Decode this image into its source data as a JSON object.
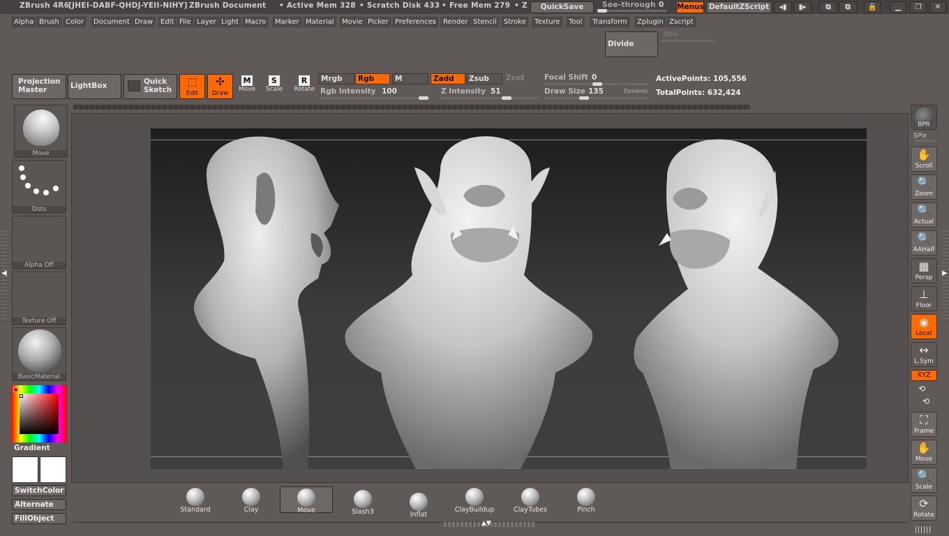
{
  "titlebar": {
    "app": "ZBrush 4R6",
    "serial": "[JHEI-DABF-QHDJ-YEII-NIHY]",
    "document": "ZBrush Document",
    "active_mem": "• Active Mem 328",
    "scratch_disk": "• Scratch Disk 433",
    "free_mem": "• Free Mem 279",
    "z_trunc": "• Z",
    "quicksave": "QuickSave",
    "see_through": "See-through",
    "see_through_value": "0",
    "menus": "Menus",
    "default_zscript": "DefaultZScript"
  },
  "menubar": {
    "items": [
      "Alpha",
      "Brush",
      "Color",
      "Document",
      "Draw",
      "Edit",
      "File",
      "Layer",
      "Light",
      "Macro",
      "Marker",
      "Material",
      "Movie",
      "Picker",
      "Preferences",
      "Render",
      "Stencil",
      "Stroke",
      "Texture",
      "Tool",
      "Transform",
      "Zplugin",
      "Zscript"
    ]
  },
  "subtool": {
    "divide": "Divide",
    "sdiv": "SDiv"
  },
  "shelf": {
    "projection_master_1": "Projection",
    "projection_master_2": "Master",
    "lightbox": "LightBox",
    "quick_sketch_1": "Quick",
    "quick_sketch_2": "Sketch",
    "edit": "Edit",
    "draw": "Draw",
    "move": "Move",
    "scale": "Scale",
    "rotate": "Rotate",
    "mrgb": "Mrgb",
    "rgb": "Rgb",
    "m": "M",
    "zadd": "Zadd",
    "zsub": "Zsub",
    "zcut": "Zcut",
    "rgb_intensity_label": "Rgb Intensity",
    "rgb_intensity_value": "100",
    "z_intensity_label": "Z Intensity",
    "z_intensity_value": "51",
    "focal_shift_label": "Focal Shift",
    "focal_shift_value": "0",
    "draw_size_label": "Draw Size",
    "draw_size_value": "135",
    "dynamic": "Dynamic",
    "active_points": "ActivePoints: 105,556",
    "total_points": "TotalPoints: 632,424"
  },
  "left_panel": {
    "brush_caption": "Move",
    "stroke_caption": "Dots",
    "alpha_caption": "Alpha  Off",
    "texture_caption": "Texture  Off",
    "material_caption": "BasicMaterial",
    "gradient": "Gradient",
    "switch_color": "SwitchColor",
    "alternate": "Alternate",
    "fill_object": "FillObject"
  },
  "right_panel": {
    "bpr": "BPR",
    "spix": "SPix",
    "scroll": "Scroll",
    "zoom": "Zoom",
    "actual": "Actual",
    "aahalf": "AAHalf",
    "persp": "Persp",
    "floor": "Floor",
    "local": "Local",
    "lsym": "L.Sym",
    "xyz": "XYZ",
    "frame": "Frame",
    "move": "Move",
    "scale": "Scale",
    "rotate": "Rotate"
  },
  "brushes": [
    {
      "name": "Standard"
    },
    {
      "name": "Clay"
    },
    {
      "name": "Move"
    },
    {
      "name": "Slash3"
    },
    {
      "name": "Inflat"
    },
    {
      "name": "ClayBuildup"
    },
    {
      "name": "ClayTubes"
    },
    {
      "name": "Pinch"
    }
  ],
  "colors": {
    "accent": "#ff6a00",
    "ui_bg": "#5f5a58"
  }
}
